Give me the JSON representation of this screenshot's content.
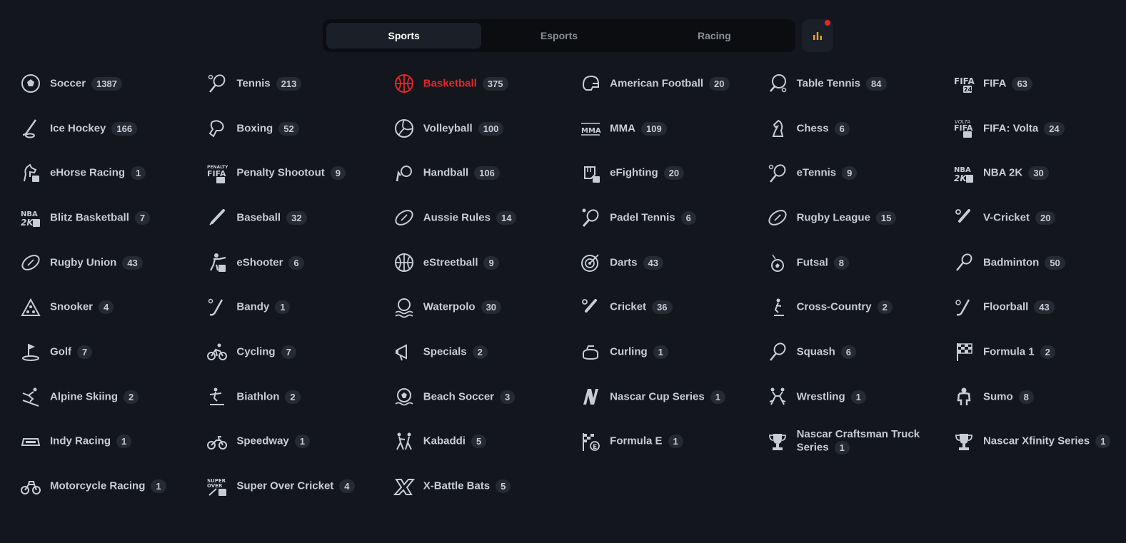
{
  "tabs": [
    {
      "label": "Sports",
      "active": true
    },
    {
      "label": "Esports",
      "active": false
    },
    {
      "label": "Racing",
      "active": false
    }
  ],
  "stats_icon": "bar-chart-icon",
  "accent": "#e0282c",
  "sports": [
    {
      "name": "Soccer",
      "count": "1387",
      "icon": "soccer-ball-icon"
    },
    {
      "name": "Tennis",
      "count": "213",
      "icon": "tennis-racket-icon"
    },
    {
      "name": "Basketball",
      "count": "375",
      "icon": "basketball-icon",
      "active": true
    },
    {
      "name": "American Football",
      "count": "20",
      "icon": "football-helmet-icon"
    },
    {
      "name": "Table Tennis",
      "count": "84",
      "icon": "ping-pong-paddle-icon"
    },
    {
      "name": "FIFA",
      "count": "63",
      "icon": "fifa-logo-icon"
    },
    {
      "name": "Ice Hockey",
      "count": "166",
      "icon": "hockey-stick-icon"
    },
    {
      "name": "Boxing",
      "count": "52",
      "icon": "boxing-glove-icon"
    },
    {
      "name": "Volleyball",
      "count": "100",
      "icon": "volleyball-icon"
    },
    {
      "name": "MMA",
      "count": "109",
      "icon": "mma-logo-icon"
    },
    {
      "name": "Chess",
      "count": "6",
      "icon": "chess-knight-icon"
    },
    {
      "name": "FIFA: Volta",
      "count": "24",
      "icon": "fifa-volta-logo-icon"
    },
    {
      "name": "eHorse Racing",
      "count": "1",
      "icon": "horse-head-icon"
    },
    {
      "name": "Penalty Shootout",
      "count": "9",
      "icon": "penalty-fifa-logo-icon"
    },
    {
      "name": "Handball",
      "count": "106",
      "icon": "handball-icon"
    },
    {
      "name": "eFighting",
      "count": "20",
      "icon": "fist-icon"
    },
    {
      "name": "eTennis",
      "count": "9",
      "icon": "tennis-racket-icon"
    },
    {
      "name": "NBA 2K",
      "count": "30",
      "icon": "nba2k-logo-icon"
    },
    {
      "name": "Blitz Basketball",
      "count": "7",
      "icon": "nba2k-blitz-logo-icon"
    },
    {
      "name": "Baseball",
      "count": "32",
      "icon": "baseball-bat-icon"
    },
    {
      "name": "Aussie Rules",
      "count": "14",
      "icon": "oval-ball-icon"
    },
    {
      "name": "Padel Tennis",
      "count": "6",
      "icon": "padel-racket-icon"
    },
    {
      "name": "Rugby League",
      "count": "15",
      "icon": "rugby-ball-icon"
    },
    {
      "name": "V-Cricket",
      "count": "20",
      "icon": "cricket-bat-icon"
    },
    {
      "name": "Rugby Union",
      "count": "43",
      "icon": "rugby-ball-icon"
    },
    {
      "name": "eShooter",
      "count": "6",
      "icon": "shooter-icon"
    },
    {
      "name": "eStreetball",
      "count": "9",
      "icon": "basketball-icon"
    },
    {
      "name": "Darts",
      "count": "43",
      "icon": "dartboard-icon"
    },
    {
      "name": "Futsal",
      "count": "8",
      "icon": "futsal-icon"
    },
    {
      "name": "Badminton",
      "count": "50",
      "icon": "badminton-racket-icon"
    },
    {
      "name": "Snooker",
      "count": "4",
      "icon": "snooker-triangle-icon"
    },
    {
      "name": "Bandy",
      "count": "1",
      "icon": "bandy-stick-icon"
    },
    {
      "name": "Waterpolo",
      "count": "30",
      "icon": "waterpolo-icon"
    },
    {
      "name": "Cricket",
      "count": "36",
      "icon": "cricket-bat-icon"
    },
    {
      "name": "Cross-Country",
      "count": "2",
      "icon": "skier-icon"
    },
    {
      "name": "Floorball",
      "count": "43",
      "icon": "floorball-stick-icon"
    },
    {
      "name": "Golf",
      "count": "7",
      "icon": "golf-flag-icon"
    },
    {
      "name": "Cycling",
      "count": "7",
      "icon": "cyclist-icon"
    },
    {
      "name": "Specials",
      "count": "2",
      "icon": "megaphone-icon"
    },
    {
      "name": "Curling",
      "count": "1",
      "icon": "curling-stone-icon"
    },
    {
      "name": "Squash",
      "count": "6",
      "icon": "squash-racket-icon"
    },
    {
      "name": "Formula 1",
      "count": "2",
      "icon": "checkered-flag-icon"
    },
    {
      "name": "Alpine Skiing",
      "count": "2",
      "icon": "downhill-skier-icon"
    },
    {
      "name": "Biathlon",
      "count": "2",
      "icon": "biathlon-icon"
    },
    {
      "name": "Beach Soccer",
      "count": "3",
      "icon": "beach-ball-icon"
    },
    {
      "name": "Nascar Cup Series",
      "count": "1",
      "icon": "nascar-n-icon"
    },
    {
      "name": "Wrestling",
      "count": "1",
      "icon": "wrestlers-icon"
    },
    {
      "name": "Sumo",
      "count": "8",
      "icon": "sumo-icon"
    },
    {
      "name": "Indy Racing",
      "count": "1",
      "icon": "race-car-icon"
    },
    {
      "name": "Speedway",
      "count": "1",
      "icon": "motorbike-icon"
    },
    {
      "name": "Kabaddi",
      "count": "5",
      "icon": "kabaddi-icon"
    },
    {
      "name": "Formula E",
      "count": "1",
      "icon": "formula-e-flag-icon"
    },
    {
      "name": "Nascar Craftsman Truck Series",
      "count": "1",
      "icon": "trophy-icon",
      "wrap": true
    },
    {
      "name": "Nascar Xfinity Series",
      "count": "1",
      "icon": "trophy-icon"
    },
    {
      "name": "Motorcycle Racing",
      "count": "1",
      "icon": "motorcycle-icon"
    },
    {
      "name": "Super Over Cricket",
      "count": "4",
      "icon": "super-over-logo-icon"
    },
    {
      "name": "X-Battle Bats",
      "count": "5",
      "icon": "x-battle-logo-icon"
    }
  ]
}
